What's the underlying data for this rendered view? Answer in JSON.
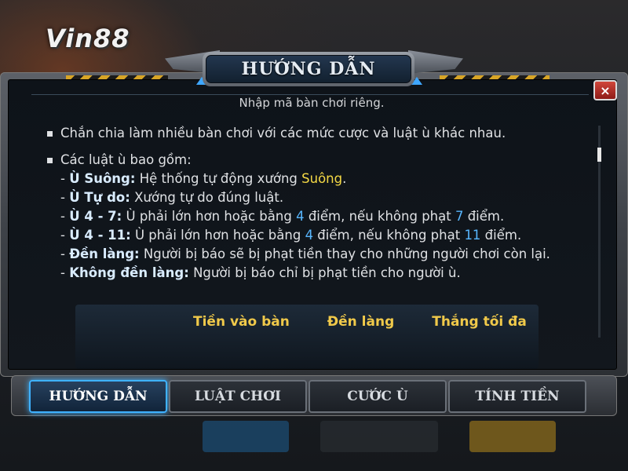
{
  "logo": {
    "text": "Vin88"
  },
  "dialog": {
    "title": "HƯỚNG DẪN",
    "subtitle": "Nhập mã bàn chơi riêng.",
    "close_label": "×",
    "bullets": [
      "Chắn chia làm nhiều bàn chơi với các mức cược và luật ù khác nhau.",
      "Các luật ù bao gồm:"
    ],
    "rules": [
      {
        "prefix": "- ",
        "name": "Ù Suông:",
        "parts": [
          "Hệ thống tự động xướng ",
          "Suông",
          "."
        ]
      },
      {
        "prefix": "- ",
        "name": "Ù Tự do:",
        "parts": [
          "Xướng tự do đúng luật."
        ]
      },
      {
        "prefix": "- ",
        "name": "Ù 4 - 7:",
        "parts": [
          "Ù phải lớn hơn hoặc bằng ",
          "4",
          " điểm, nếu không phạt ",
          "7",
          " điểm."
        ]
      },
      {
        "prefix": "- ",
        "name": "Ù 4 - 11:",
        "parts": [
          "Ù phải lớn hơn hoặc bằng ",
          "4",
          " điểm, nếu không phạt ",
          "11",
          " điểm."
        ]
      },
      {
        "prefix": "- ",
        "name": "Đền làng:",
        "parts": [
          "Người bị báo sẽ bị phạt tiền thay cho những người chơi còn lại."
        ]
      },
      {
        "prefix": "- ",
        "name": "Không đền làng:",
        "parts": [
          "Người bị báo chỉ bị phạt tiền cho người ù."
        ]
      }
    ],
    "table_headers": [
      "Tiền vào bàn",
      "Đền làng",
      "Thắng tối đa"
    ]
  },
  "tabs": [
    {
      "label": "HƯỚNG DẪN",
      "active": true
    },
    {
      "label": "LUẬT CHƠI",
      "active": false
    },
    {
      "label": "CƯỚC Ù",
      "active": false
    },
    {
      "label": "TÍNH TIỀN",
      "active": false
    }
  ],
  "colors": {
    "accent": "#3fb2ff",
    "highlight": "#f5d945",
    "number": "#58b7ff",
    "header": "#f0c94a"
  }
}
